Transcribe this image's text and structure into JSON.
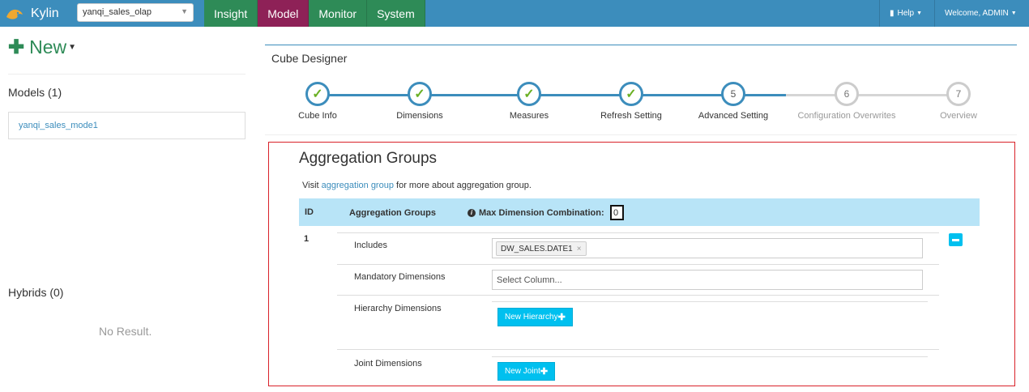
{
  "navbar": {
    "brand": "Kylin",
    "project": "yanqi_sales_olap",
    "tabs": [
      {
        "label": "Insight"
      },
      {
        "label": "Model"
      },
      {
        "label": "Monitor"
      },
      {
        "label": "System"
      }
    ],
    "help": "Help",
    "welcome": "Welcome, ADMIN"
  },
  "sidebar": {
    "new_label": "New",
    "models_title": "Models (1)",
    "models": [
      "yanqi_sales_mode1"
    ],
    "hybrids_title": "Hybrids (0)",
    "no_result": "No Result."
  },
  "designer": {
    "title": "Cube Designer",
    "steps": [
      {
        "label": "Cube Info",
        "state": "done",
        "num": ""
      },
      {
        "label": "Dimensions",
        "state": "done",
        "num": ""
      },
      {
        "label": "Measures",
        "state": "done",
        "num": ""
      },
      {
        "label": "Refresh Setting",
        "state": "done",
        "num": ""
      },
      {
        "label": "Advanced Setting",
        "state": "current",
        "num": "5"
      },
      {
        "label": "Configuration Overwrites",
        "state": "pending",
        "num": "6"
      },
      {
        "label": "Overview",
        "state": "pending",
        "num": "7"
      }
    ]
  },
  "aggregation": {
    "title": "Aggregation Groups",
    "visit_prefix": "Visit",
    "visit_link": "aggregation group",
    "visit_suffix": "for more about aggregation group.",
    "header_id": "ID",
    "header_groups": "Aggregation Groups",
    "header_max": "Max Dimension Combination:",
    "max_value": "0",
    "row_id": "1",
    "includes_label": "Includes",
    "includes_tag": "DW_SALES.DATE1",
    "mandatory_label": "Mandatory Dimensions",
    "mandatory_placeholder": "Select Column...",
    "hierarchy_label": "Hierarchy Dimensions",
    "new_hierarchy": "New Hierarchy",
    "joint_label": "Joint Dimensions",
    "new_joint": "New Joint"
  },
  "colors": {
    "nav_blue": "#3c8dbc",
    "nav_green": "#2e8b57",
    "nav_active": "#8e2157",
    "step_done_check": "#6ab023",
    "panel_border": "#d9222a",
    "header_bg": "#b8e4f7",
    "cyan_button": "#00c0ef"
  }
}
